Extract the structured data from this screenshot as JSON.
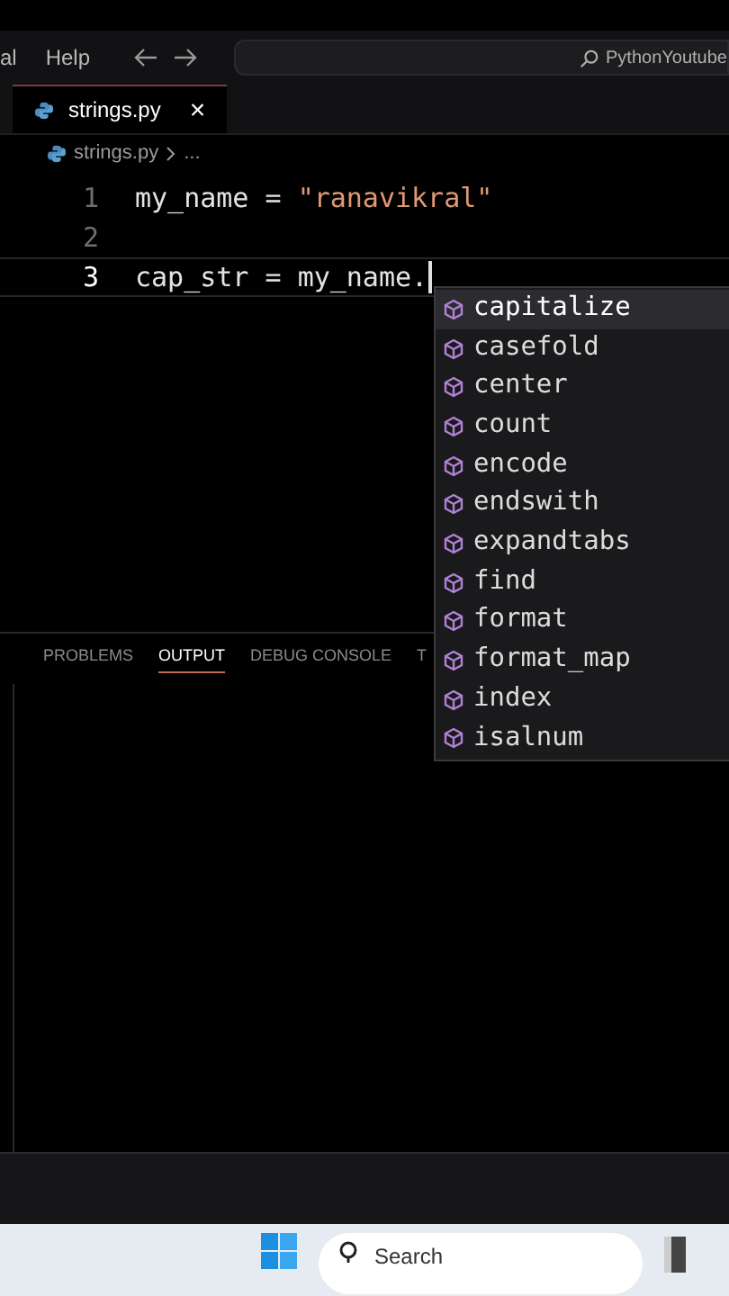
{
  "menu": [
    "al",
    "Help"
  ],
  "command_center": {
    "text": "PythonYoutube"
  },
  "tabs": [
    {
      "label": "strings.py",
      "selected": true
    }
  ],
  "close_glyph": "×",
  "breadcrumb": [
    "strings.py",
    "..."
  ],
  "editor": {
    "lines": [
      {
        "number": "1",
        "active": false,
        "tokens": [
          {
            "kind": "var",
            "text": "my_name"
          },
          {
            "kind": "op",
            "text": " = "
          },
          {
            "kind": "str",
            "text": "\"ranavikral\""
          }
        ]
      },
      {
        "number": "2",
        "active": false
      },
      {
        "number": "3",
        "active": true,
        "tokens": [
          {
            "kind": "var",
            "text": "cap_str"
          },
          {
            "kind": "op",
            "text": " = "
          },
          {
            "kind": "var",
            "text": "my_name"
          },
          {
            "kind": "op",
            "text": "."
          }
        ]
      }
    ]
  },
  "suggestions": [
    {
      "label": "capitalize",
      "selected": true
    },
    {
      "label": "casefold",
      "selected": false
    },
    {
      "label": "center",
      "selected": false
    },
    {
      "label": "count",
      "selected": false
    },
    {
      "label": "encode",
      "selected": false
    },
    {
      "label": "endswith",
      "selected": false
    },
    {
      "label": "expandtabs",
      "selected": false
    },
    {
      "label": "find",
      "selected": false
    },
    {
      "label": "format",
      "selected": false
    },
    {
      "label": "format_map",
      "selected": false
    },
    {
      "label": "index",
      "selected": false
    },
    {
      "label": "isalnum",
      "selected": false
    }
  ],
  "panel_tabs": [
    {
      "label": "PROBLEMS",
      "selected": false
    },
    {
      "label": "OUTPUT",
      "selected": true
    },
    {
      "label": "DEBUG CONSOLE",
      "selected": false
    },
    {
      "label": "T",
      "selected": false
    }
  ],
  "taskbar": {
    "search_placeholder": "Search"
  }
}
